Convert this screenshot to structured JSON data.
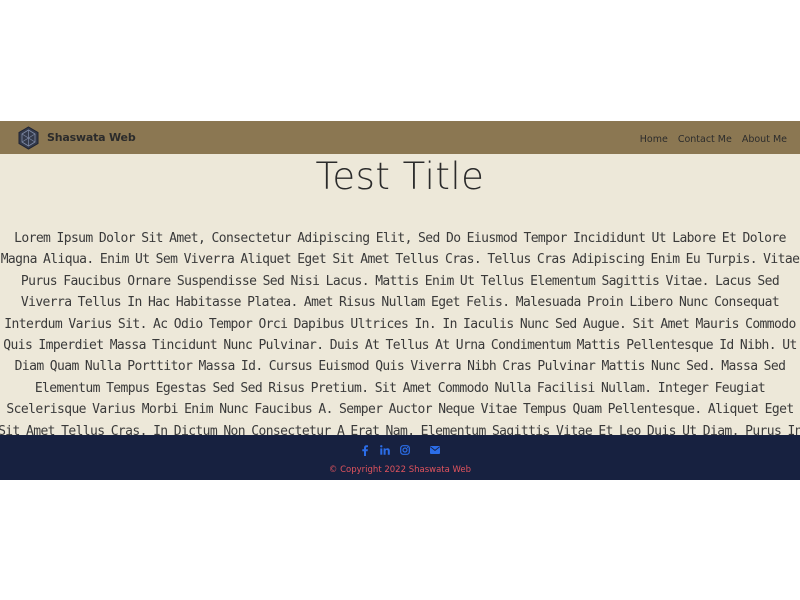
{
  "navbar": {
    "brand_name": "Shaswata Web",
    "links": [
      "Home",
      "Contact Me",
      "About Me"
    ]
  },
  "main": {
    "title": "Test Title",
    "body": "Lorem Ipsum Dolor Sit Amet, Consectetur Adipiscing Elit, Sed Do Eiusmod Tempor Incididunt Ut Labore Et Dolore Magna Aliqua. Enim Ut Sem Viverra Aliquet Eget Sit Amet Tellus Cras. Tellus Cras Adipiscing Enim Eu Turpis. Vitae Purus Faucibus Ornare Suspendisse Sed Nisi Lacus. Mattis Enim Ut Tellus Elementum Sagittis Vitae. Lacus Sed Viverra Tellus In Hac Habitasse Platea. Amet Risus Nullam Eget Felis. Malesuada Proin Libero Nunc Consequat Interdum Varius Sit. Ac Odio Tempor Orci Dapibus Ultrices In. In Iaculis Nunc Sed Augue. Sit Amet Mauris Commodo Quis Imperdiet Massa Tincidunt Nunc Pulvinar. Duis At Tellus At Urna Condimentum Mattis Pellentesque Id Nibh. Ut Diam Quam Nulla Porttitor Massa Id. Cursus Euismod Quis Viverra Nibh Cras Pulvinar Mattis Nunc Sed. Massa Sed Elementum Tempus Egestas Sed Sed Risus Pretium. Sit Amet Commodo Nulla Facilisi Nullam. Integer Feugiat Scelerisque Varius Morbi Enim Nunc Faucibus A. Semper Auctor Neque Vitae Tempus Quam Pellentesque. Aliquet Eget Sit Amet Tellus Cras. In Dictum Non Consectetur A Erat Nam. Elementum Sagittis Vitae Et Leo Duis Ut Diam. Purus In"
  },
  "footer": {
    "social_icons": [
      "facebook-icon",
      "linkedin-icon",
      "instagram-icon",
      "envelope-icon"
    ],
    "copyright_prefix": "© Copyright 2022 ",
    "copyright_name": "Shaswata Web"
  },
  "colors": {
    "navbar_bg": "#8b7752",
    "content_bg": "#ede8d9",
    "footer_bg": "#172140",
    "icon_blue": "#2b6de8",
    "copyright_red": "#e0535d"
  }
}
